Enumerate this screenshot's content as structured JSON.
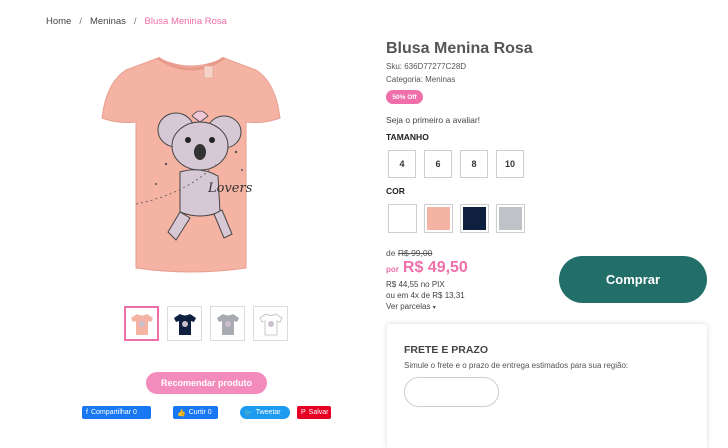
{
  "breadcrumb": {
    "home": "Home",
    "category": "Meninas",
    "current": "Blusa Menina Rosa",
    "separator": "/"
  },
  "product": {
    "title": "Blusa Menina Rosa",
    "sku": "Sku: 636D77277C28D",
    "category": "Categoria: Meninas",
    "discount_badge": "50% Off",
    "review_link": "Seja o primeiro a avaliar!",
    "hero_print_text": "Lovers"
  },
  "sizes": {
    "label": "TAMANHO",
    "options": [
      "4",
      "6",
      "8",
      "10"
    ]
  },
  "colors": {
    "label": "COR",
    "options": [
      "#ffffff",
      "#f4b3a3",
      "#0e1f3f",
      "#bfc2c7"
    ]
  },
  "gallery": {
    "thumbnail_colors": [
      "#f4b3a3",
      "#0e1f3f",
      "#a8abb0",
      "#ffffff"
    ],
    "active_index": 0
  },
  "price": {
    "old_prefix": "de",
    "old_value": "R$ 99,00",
    "now_prefix": "por",
    "now_value": "R$ 49,50",
    "pix": "R$ 44,55 no PIX",
    "installments": "ou em 4x de R$ 13,31",
    "installments_link": "Ver parcelas"
  },
  "actions": {
    "buy_label": "Comprar",
    "recommend_label": "Recomendar produto"
  },
  "social": {
    "fb_share": "Compartilhar 0",
    "fb_like": "Curtir 0",
    "tweet": "Tweetar",
    "pin": "Salvar"
  },
  "shipping": {
    "title": "FRETE E PRAZO",
    "description": "Simule o frete e o prazo de entrega estimados para sua região:",
    "input_placeholder": ""
  },
  "accent_colors": {
    "pink": "#ee6fa9",
    "teal": "#226e68"
  }
}
